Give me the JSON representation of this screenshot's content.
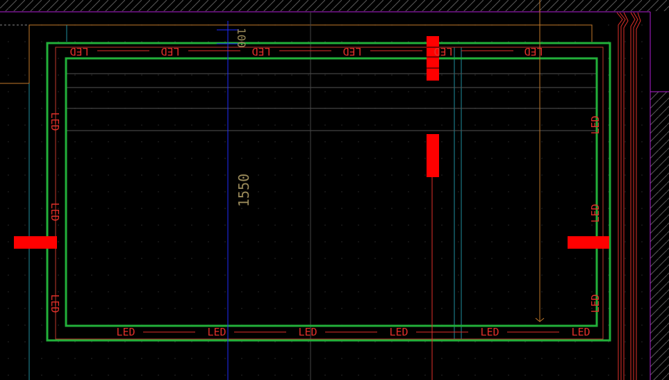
{
  "drawing": {
    "background": "#000000",
    "dimension_text": "1550",
    "dimension_text_top": "100",
    "led_label": "LED",
    "colors": {
      "frame_green": "#22b03a",
      "led_red": "#e2302a",
      "marker_red": "#ff0000",
      "axis_blue": "#1f2cff",
      "wall_purple": "#b21fd6",
      "cyan_line": "#1f8fa0",
      "orange_line": "#c47a2a",
      "hatch_gray": "#5a5a5a",
      "grid_dot": "#2c2c2c",
      "dim_text": "#9a8a5a"
    }
  }
}
